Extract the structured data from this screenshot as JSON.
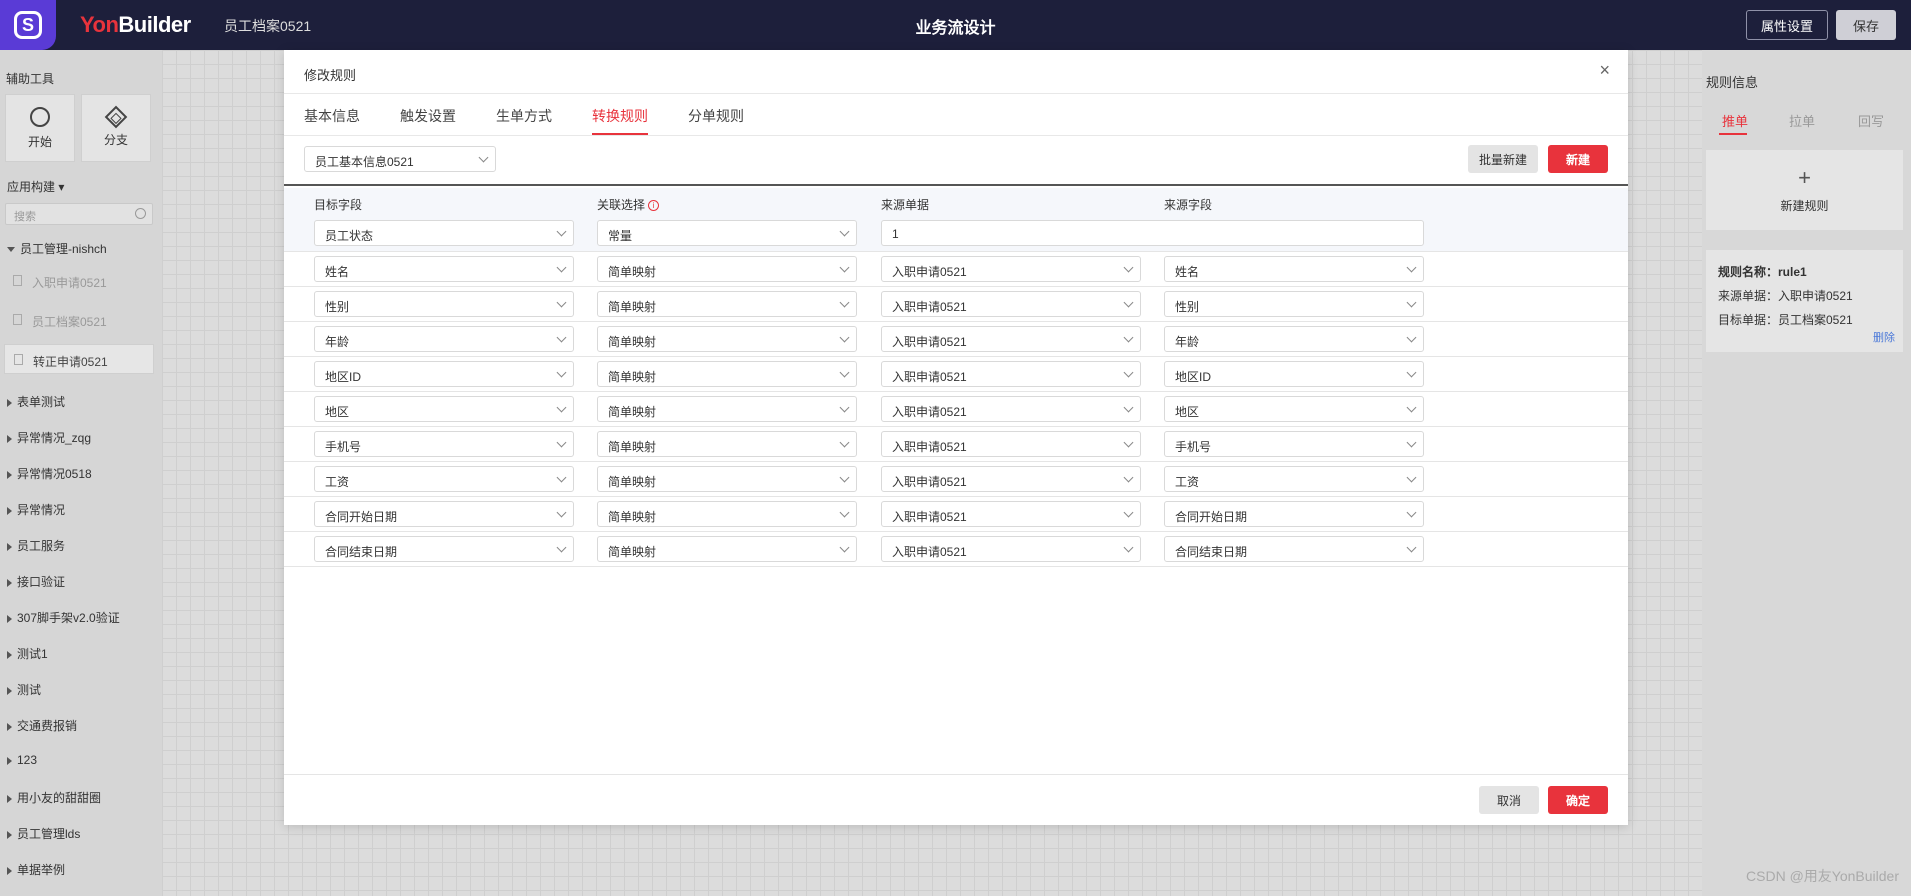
{
  "header": {
    "brand_yon": "Yon",
    "brand_builder": "Builder",
    "doc_name": "员工档案0521",
    "page_title": "业务流设计",
    "attr_button": "属性设置",
    "save_button": "保存"
  },
  "left_panel": {
    "title": "辅助工具",
    "tools": [
      "开始",
      "分支"
    ],
    "section": "应用构建",
    "search_placeholder": "搜索",
    "group_expanded": "员工管理-nishch",
    "sub_items": [
      "入职申请0521",
      "员工档案0521",
      "转正申请0521"
    ],
    "groups": [
      "表单测试",
      "异常情况_zqg",
      "异常情况0518",
      "异常情况",
      "员工服务",
      "接口验证",
      "307脚手架v2.0验证",
      "测试1",
      "测试",
      "交通费报销",
      "123",
      "用小友的甜甜圈",
      "员工管理lds",
      "单据举例"
    ]
  },
  "right_panel": {
    "title": "规则信息",
    "tabs": [
      "推单",
      "拉单",
      "回写"
    ],
    "new_rule": "新建规则",
    "rule_name": "规则名称：rule1",
    "source_doc": "来源单据：入职申请0521",
    "target_doc": "目标单据：员工档案0521",
    "delete": "删除"
  },
  "modal": {
    "title": "修改规则",
    "close": "×",
    "tabs": [
      "基本信息",
      "触发设置",
      "生单方式",
      "转换规则",
      "分单规则"
    ],
    "target_select": "员工基本信息0521",
    "batch_new": "批量新建",
    "new": "新建",
    "columns": [
      "目标字段",
      "关联选择",
      "来源单据",
      "来源字段"
    ],
    "info_icon": "i",
    "first_row": {
      "target": "员工状态",
      "relation": "常量",
      "value": "1"
    },
    "rows": [
      {
        "target": "姓名",
        "relation": "简单映射",
        "source_doc": "入职申请0521",
        "source_field": "姓名"
      },
      {
        "target": "性别",
        "relation": "简单映射",
        "source_doc": "入职申请0521",
        "source_field": "性别"
      },
      {
        "target": "年龄",
        "relation": "简单映射",
        "source_doc": "入职申请0521",
        "source_field": "年龄"
      },
      {
        "target": "地区ID",
        "relation": "简单映射",
        "source_doc": "入职申请0521",
        "source_field": "地区ID"
      },
      {
        "target": "地区",
        "relation": "简单映射",
        "source_doc": "入职申请0521",
        "source_field": "地区"
      },
      {
        "target": "手机号",
        "relation": "简单映射",
        "source_doc": "入职申请0521",
        "source_field": "手机号"
      },
      {
        "target": "工资",
        "relation": "简单映射",
        "source_doc": "入职申请0521",
        "source_field": "工资"
      },
      {
        "target": "合同开始日期",
        "relation": "简单映射",
        "source_doc": "入职申请0521",
        "source_field": "合同开始日期"
      },
      {
        "target": "合同结束日期",
        "relation": "简单映射",
        "source_doc": "入职申请0521",
        "source_field": "合同结束日期"
      }
    ],
    "cancel": "取消",
    "ok": "确定"
  },
  "watermark": "CSDN @用友YonBuilder",
  "colors": {
    "accent": "#e8333c",
    "topbar": "#1d1f3b",
    "logo": "#5a3bd6"
  }
}
